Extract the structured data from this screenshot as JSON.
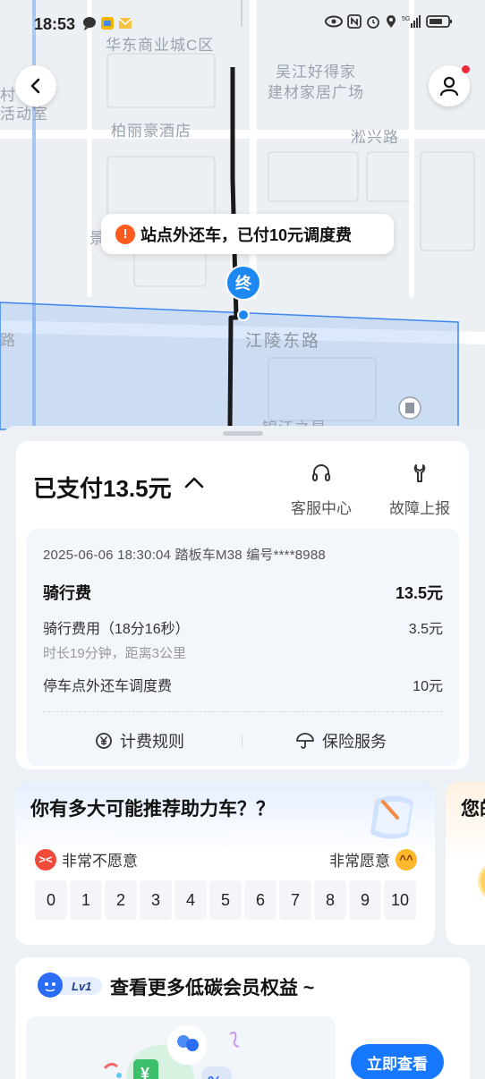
{
  "status_bar": {
    "time": "18:53"
  },
  "map": {
    "labels": {
      "mall": "华东商业城C区",
      "building_materials_1": "吴江好得家",
      "building_materials_2": "建材家居广场",
      "hotel": "柏丽豪酒店",
      "songxing_road": "淞兴路",
      "jiangling_east_road": "江陵东路",
      "left_road": "路",
      "left_activity_1": "村",
      "left_activity_2": "活动室",
      "partial_jing": "景",
      "bottom_partial": "锦江之星"
    },
    "end_marker": "终",
    "tip": {
      "icon": "!",
      "text": "站点外还车，已付10元调度费"
    },
    "colors": {
      "route": "#1a1a1a",
      "zone": "#3b86f0",
      "marker": "#1e88f2"
    }
  },
  "payment": {
    "title": "已支付13.5元",
    "service_center": "客服中心",
    "report_fault": "故障上报",
    "order_meta": "2025-06-06 18:30:04 踏板车M38 编号****8988",
    "ride_fee_label": "骑行费",
    "ride_fee_value": "13.5元",
    "ride_cost_label": "骑行费用（18分16秒）",
    "ride_cost_value": "3.5元",
    "ride_duration": "时长19分钟，距离3公里",
    "dispatch_label": "停车点外还车调度费",
    "dispatch_value": "10元",
    "pricing_rules": "计费规则",
    "insurance": "保险服务"
  },
  "nps": {
    "question": "你有多大可能推荐助力车？？",
    "low_label": "非常不愿意",
    "high_label": "非常愿意",
    "scale": [
      "0",
      "1",
      "2",
      "3",
      "4",
      "5",
      "6",
      "7",
      "8",
      "9",
      "10"
    ]
  },
  "peek_card": {
    "text": "您的"
  },
  "member": {
    "badge": "Lv1",
    "title": "查看更多低碳会员权益 ~",
    "button": "立即查看",
    "coupon_symbol": "¥",
    "discount_symbol": "%"
  }
}
